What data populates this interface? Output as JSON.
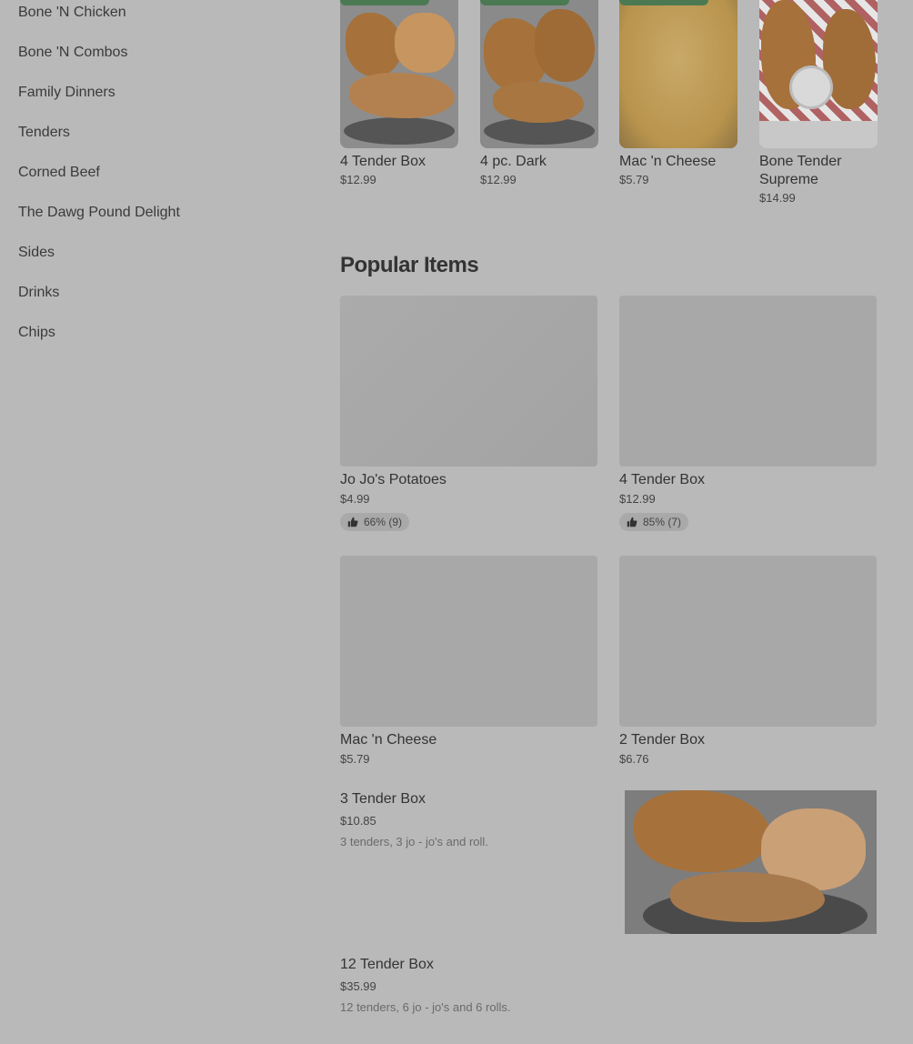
{
  "sidebar": {
    "items": [
      {
        "label": "Bone 'N Chicken"
      },
      {
        "label": "Bone 'N Combos"
      },
      {
        "label": "Family Dinners"
      },
      {
        "label": "Tenders"
      },
      {
        "label": "Corned Beef"
      },
      {
        "label": "The Dawg Pound Delight"
      },
      {
        "label": "Sides"
      },
      {
        "label": "Drinks"
      },
      {
        "label": "Chips"
      }
    ]
  },
  "carousel": {
    "items": [
      {
        "name": "4 Tender Box",
        "price": "$12.99"
      },
      {
        "name": "4 pc. Dark",
        "price": "$12.99"
      },
      {
        "name": "Mac 'n Cheese",
        "price": "$5.79"
      },
      {
        "name": "Bone Tender Supreme",
        "price": "$14.99"
      }
    ]
  },
  "popular": {
    "title": "Popular Items",
    "items": [
      {
        "name": "Jo Jo's Potatoes",
        "price": "$4.99",
        "rating": "66% (9)"
      },
      {
        "name": "4 Tender Box",
        "price": "$12.99",
        "rating": "85% (7)"
      },
      {
        "name": "Mac 'n Cheese",
        "price": "$5.79"
      },
      {
        "name": "2 Tender Box",
        "price": "$6.76"
      }
    ]
  },
  "list": {
    "items": [
      {
        "name": "3 Tender Box",
        "price": "$10.85",
        "desc": "3 tenders, 3 jo - jo's and roll."
      },
      {
        "name": "12 Tender Box",
        "price": "$35.99",
        "desc": "12 tenders, 6 jo - jo's and 6 rolls."
      }
    ]
  },
  "icons": {
    "rating": "thumbs-up-icon"
  },
  "colors": {
    "overlay_bg": "#b9b9b9",
    "tag": "#4b7a52"
  }
}
